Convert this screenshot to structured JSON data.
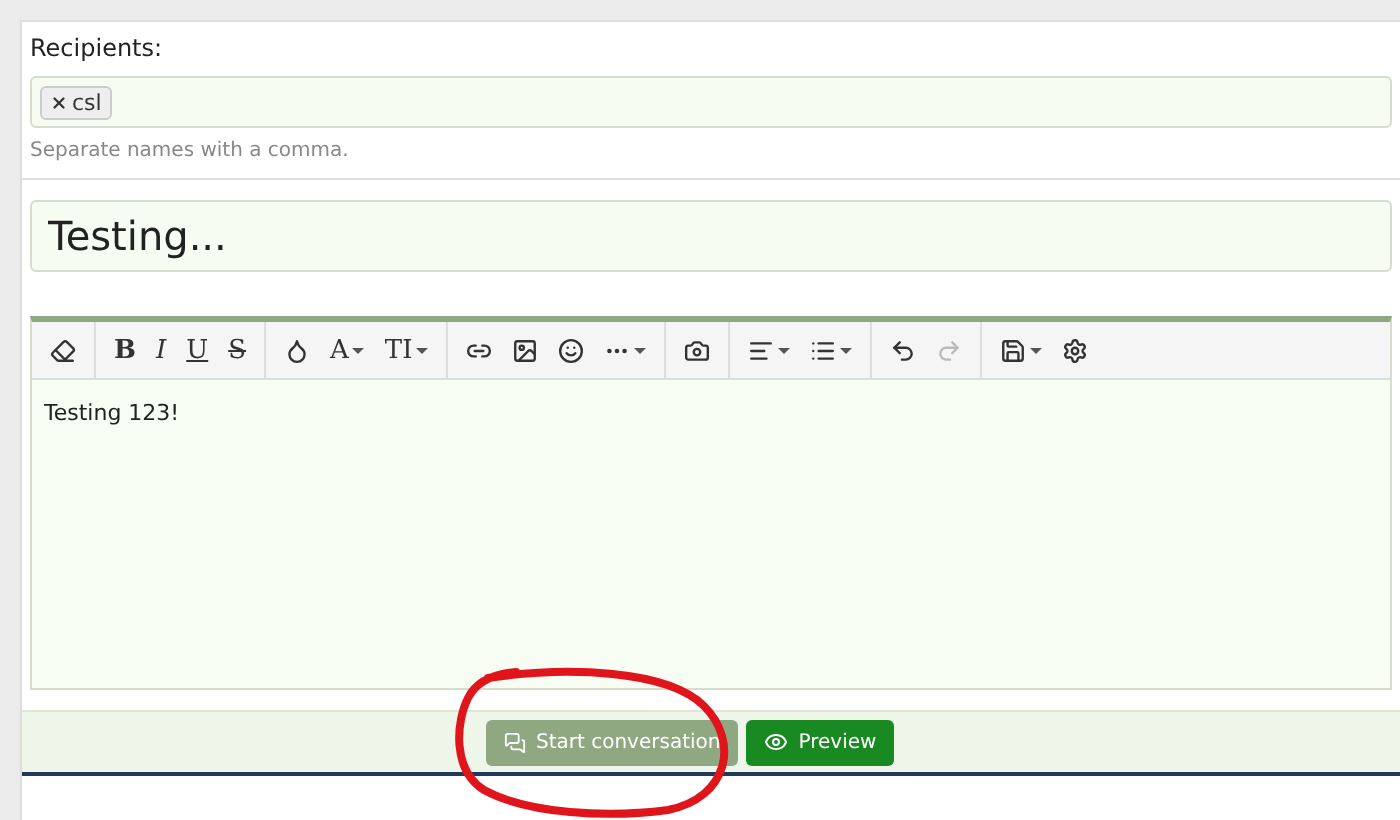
{
  "recipients": {
    "label": "Recipients:",
    "tokens": [
      {
        "text": "csl"
      }
    ],
    "hint": "Separate names with a comma."
  },
  "title_field": {
    "value": "Testing..."
  },
  "toolbar": {
    "groups": [
      [
        {
          "kind": "eraser",
          "disabled": false,
          "dropdown": false
        }
      ],
      [
        {
          "kind": "bold",
          "label": "B",
          "disabled": false,
          "dropdown": false
        },
        {
          "kind": "italic",
          "label": "I",
          "disabled": false,
          "dropdown": false
        },
        {
          "kind": "underline",
          "label": "U",
          "disabled": false,
          "dropdown": false
        },
        {
          "kind": "strike",
          "label": "S",
          "disabled": false,
          "dropdown": false
        }
      ],
      [
        {
          "kind": "color",
          "disabled": false,
          "dropdown": false
        },
        {
          "kind": "font",
          "label": "A",
          "disabled": false,
          "dropdown": true
        },
        {
          "kind": "size",
          "label": "TI",
          "disabled": false,
          "dropdown": true
        }
      ],
      [
        {
          "kind": "link",
          "disabled": false,
          "dropdown": false
        },
        {
          "kind": "image",
          "disabled": false,
          "dropdown": false
        },
        {
          "kind": "smilie",
          "disabled": false,
          "dropdown": false
        },
        {
          "kind": "more",
          "disabled": false,
          "dropdown": true
        }
      ],
      [
        {
          "kind": "camera",
          "disabled": false,
          "dropdown": false
        }
      ],
      [
        {
          "kind": "align",
          "disabled": false,
          "dropdown": true
        },
        {
          "kind": "list",
          "disabled": false,
          "dropdown": true
        }
      ],
      [
        {
          "kind": "undo",
          "disabled": false,
          "dropdown": false
        },
        {
          "kind": "redo",
          "disabled": true,
          "dropdown": false
        }
      ],
      [
        {
          "kind": "save",
          "disabled": false,
          "dropdown": true
        },
        {
          "kind": "settings",
          "disabled": false,
          "dropdown": false
        }
      ]
    ]
  },
  "editor": {
    "text": "Testing 123!"
  },
  "buttons": [
    {
      "kind": "start",
      "label": "Start conversation"
    },
    {
      "kind": "preview",
      "label": "Preview"
    }
  ],
  "annotation": {
    "kind": "circle"
  }
}
